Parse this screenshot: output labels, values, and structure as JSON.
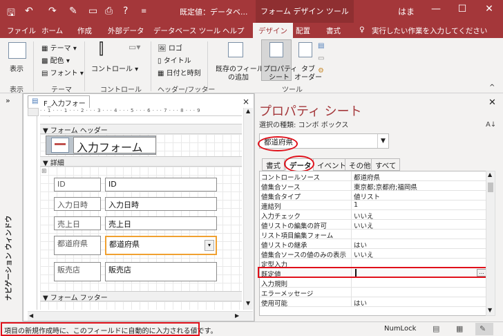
{
  "titlebar": {
    "save_icon": "save-icon",
    "undo_icon": "undo-icon",
    "doc_title": "既定値：データベ...",
    "context_tab": "フォーム デザイン ツール",
    "user": "はま",
    "minimize": "—",
    "restore": "☐",
    "close": "✕"
  },
  "ribbon_tabs": [
    "ファイル",
    "ホーム",
    "作成",
    "外部データ",
    "データベース ツール",
    "ヘルプ",
    "デザイン",
    "配置",
    "書式"
  ],
  "tell_me": "実行したい作業を入力してください",
  "ribbon": {
    "view_label": "表示",
    "group_view": "表示",
    "theme": "テーマ",
    "colors": "配色",
    "fonts": "フォント",
    "group_theme": "テーマ",
    "controls": "コントロール",
    "group_controls": "コントロール",
    "logo": "ロゴ",
    "title": "タイトル",
    "datetime": "日付と時刻",
    "group_header": "ヘッダー/フッター",
    "add_existing": "既存のフィールド",
    "add_existing2": "の追加",
    "property_sheet": "プロパティ",
    "property_sheet2": "シート",
    "tab_order": "タブ",
    "tab_order2": "オーダー",
    "group_tools": "ツール"
  },
  "nav": {
    "label": "ナビゲーション ウィンドウ",
    "chevron": "»"
  },
  "designer": {
    "tab_title": "F_入力フォーム",
    "close": "×",
    "ruler": "· · 1 · · · 1 · · · 2 · · · 3 · · · 4 · · · 5 · · · 6 · · · 7 · · · 8 · · · 9",
    "header_section": "フォーム ヘッダー",
    "form_title": "入力フォーム",
    "detail_section": "詳細",
    "footer_section": "フォーム フッター",
    "fields": [
      {
        "label": "ID",
        "value": "ID"
      },
      {
        "label": "入力日時",
        "value": "入力日時"
      },
      {
        "label": "売上日",
        "value": "売上日"
      },
      {
        "label": "都道府県",
        "value": "都道府県"
      },
      {
        "label": "販売店",
        "value": "販売店"
      }
    ]
  },
  "property_sheet": {
    "title": "プロパティ シート",
    "subtitle": "選択の種類: コンボ ボックス",
    "selected": "都道府県",
    "tabs": [
      "書式",
      "データ",
      "イベント",
      "その他",
      "すべて"
    ],
    "rows": [
      {
        "key": "コントロールソース",
        "value": "都道府県"
      },
      {
        "key": "値集合ソース",
        "value": "東京都;京都府;福岡県"
      },
      {
        "key": "値集合タイプ",
        "value": "値リスト"
      },
      {
        "key": "連結列",
        "value": "1"
      },
      {
        "key": "入力チェック",
        "value": "いいえ"
      },
      {
        "key": "値リストの編集の許可",
        "value": "いいえ"
      },
      {
        "key": "リスト項目編集フォーム",
        "value": ""
      },
      {
        "key": "値リストの継承",
        "value": "はい"
      },
      {
        "key": "値集合ソースの値のみの表示",
        "value": "いいえ"
      },
      {
        "key": "定型入力",
        "value": ""
      },
      {
        "key": "既定値",
        "value": ""
      },
      {
        "key": "入力規則",
        "value": ""
      },
      {
        "key": "エラーメッセージ",
        "value": ""
      },
      {
        "key": "使用可能",
        "value": "はい"
      }
    ],
    "builder_button": "..."
  },
  "status": {
    "message": "項目の新規作成時に、このフィールドに自動的に入力される値です。",
    "numlock": "NumLock"
  },
  "colors": {
    "accent": "#a4373a",
    "highlight": "#e0101a",
    "selection": "#f0a030"
  }
}
